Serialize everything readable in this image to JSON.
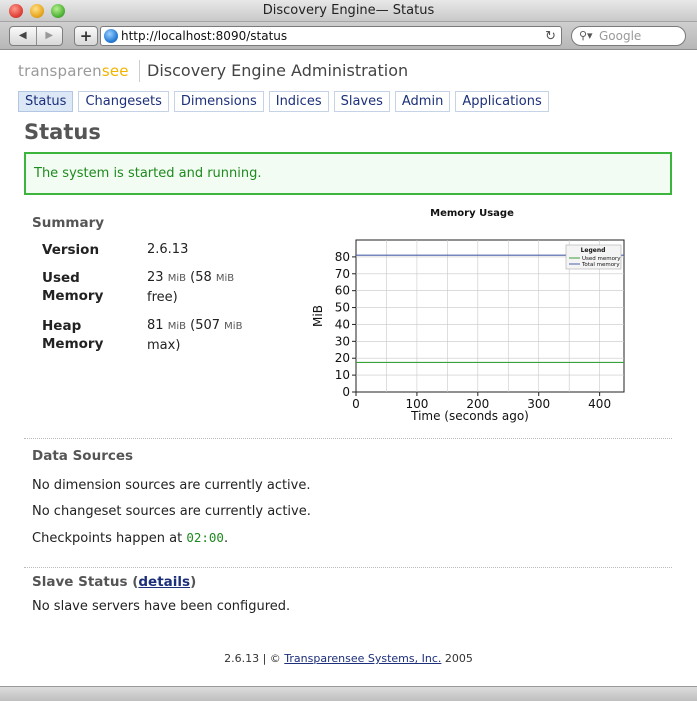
{
  "window": {
    "title": "Discovery Engine— Status",
    "url": "http://localhost:8090/status",
    "search_placeholder": "Google"
  },
  "header": {
    "logo_part1": "transparen",
    "logo_part2": "see",
    "app_title": "Discovery Engine Administration"
  },
  "tabs": [
    {
      "label": "Status"
    },
    {
      "label": "Changesets"
    },
    {
      "label": "Dimensions"
    },
    {
      "label": "Indices"
    },
    {
      "label": "Slaves"
    },
    {
      "label": "Admin"
    },
    {
      "label": "Applications"
    }
  ],
  "page": {
    "title": "Status",
    "alert": "The system is started and running."
  },
  "summary": {
    "heading": "Summary",
    "version_label": "Version",
    "version_value": "2.6.13",
    "used_label_1": "Used",
    "used_label_2": "Memory",
    "used_value": "23",
    "used_unit": "MiB",
    "used_free_value": "58",
    "used_free_unit": "MiB",
    "used_free_word": "free)",
    "heap_label_1": "Heap",
    "heap_label_2": "Memory",
    "heap_value": "81",
    "heap_unit": "MiB",
    "heap_max_value": "507",
    "heap_max_unit": "MiB",
    "heap_max_word": "max)"
  },
  "chart_data": {
    "type": "line",
    "title": "Memory Usage",
    "xlabel": "Time (seconds ago)",
    "ylabel": "MiB",
    "xlim": [
      0,
      440
    ],
    "ylim": [
      0,
      90
    ],
    "xticks": [
      0,
      100,
      200,
      300,
      400
    ],
    "yticks": [
      0,
      10,
      20,
      30,
      40,
      50,
      60,
      70,
      80
    ],
    "grid": true,
    "legend_title": "Legend",
    "legend_position": "top-right",
    "series": [
      {
        "name": "Used memory",
        "color": "#3aa13a",
        "x": [
          0,
          440
        ],
        "y": [
          17.5,
          17.5
        ]
      },
      {
        "name": "Total memory",
        "color": "#4a5fa8",
        "x": [
          0,
          440
        ],
        "y": [
          81,
          81
        ]
      }
    ]
  },
  "data_sources": {
    "heading": "Data Sources",
    "line1": "No dimension sources are currently active.",
    "line2": "No changeset sources are currently active.",
    "line3_prefix": "Checkpoints happen at ",
    "line3_time": "02:00",
    "line3_suffix": "."
  },
  "slave_status": {
    "heading": "Slave Status (",
    "details_link": "details",
    "heading_end": ")",
    "message": "No slave servers have been configured."
  },
  "footer": {
    "version": "2.6.13 | © ",
    "company": "Transparensee Systems, Inc.",
    "year": " 2005"
  }
}
